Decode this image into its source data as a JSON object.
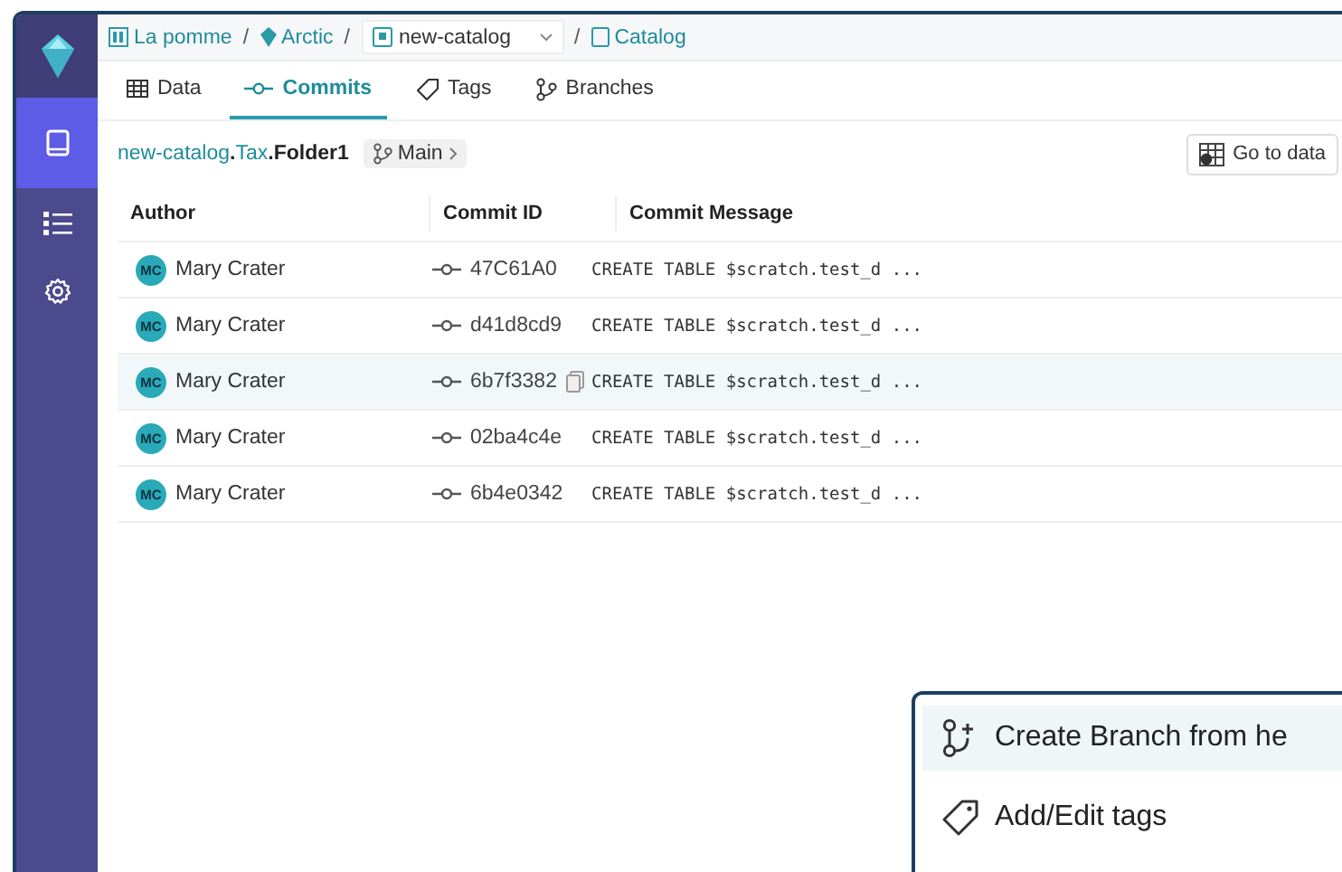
{
  "sidebar": {
    "items": [
      {
        "selected": true
      },
      {
        "selected": false
      },
      {
        "selected": false
      }
    ]
  },
  "breadcrumb": {
    "items": [
      {
        "kind": "folder",
        "label": "La pomme"
      },
      {
        "kind": "catalog",
        "separator": "/",
        "label": "Arctic"
      },
      {
        "kind": "select",
        "separator": "/",
        "label": "new-catalog"
      },
      {
        "kind": "page",
        "separator": "/",
        "label": "Catalog"
      }
    ]
  },
  "tabs": [
    {
      "label": "Data",
      "selected": false
    },
    {
      "label": "Commits",
      "selected": true
    },
    {
      "label": "Tags",
      "selected": false
    },
    {
      "label": "Branches",
      "selected": false
    }
  ],
  "path": {
    "parts": [
      {
        "label": "new-catalog"
      },
      {
        "separator": ".",
        "label": "Tax"
      },
      {
        "separator": ".",
        "label": "Folder1"
      }
    ],
    "branch": "Main"
  },
  "go_to_data": "Go to data",
  "table": {
    "columns": [
      "Author",
      "Commit ID",
      "Commit Message"
    ],
    "rows": [
      {
        "initials": "MC",
        "author": "Mary Crater",
        "commit_id": "47C61A0",
        "message": "CREATE TABLE $scratch.test_d ...",
        "selected": false
      },
      {
        "initials": "MC",
        "author": "Mary Crater",
        "commit_id": "d41d8cd9",
        "message": "CREATE TABLE $scratch.test_d ...",
        "selected": false
      },
      {
        "initials": "MC",
        "author": "Mary Crater",
        "commit_id": "6b7f3382",
        "message": "CREATE TABLE $scratch.test_d ...",
        "selected": true
      },
      {
        "initials": "MC",
        "author": "Mary Crater",
        "commit_id": "02ba4c4e",
        "message": "CREATE TABLE $scratch.test_d ...",
        "selected": false
      },
      {
        "initials": "MC",
        "author": "Mary Crater",
        "commit_id": "6b4e0342",
        "message": "CREATE TABLE $scratch.test_d ...",
        "selected": false
      }
    ]
  },
  "menu": {
    "items": [
      {
        "label": "Create Branch from he",
        "selected": true
      },
      {
        "label": "Add/Edit tags",
        "selected": false
      }
    ]
  }
}
